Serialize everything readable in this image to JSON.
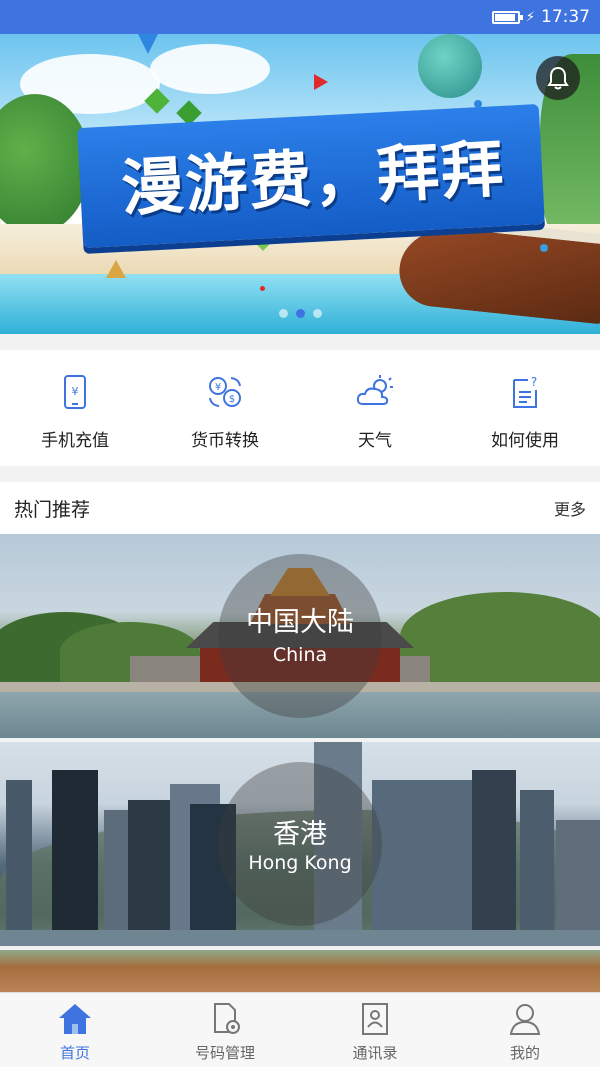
{
  "status_bar": {
    "time": "17:37"
  },
  "banner": {
    "headline": "漫游费，拜拜",
    "slide_count": 3,
    "active_slide": 2
  },
  "quick_actions": [
    {
      "label": "手机充值",
      "icon": "phone-recharge-icon"
    },
    {
      "label": "货币转换",
      "icon": "currency-exchange-icon"
    },
    {
      "label": "天气",
      "icon": "weather-icon"
    },
    {
      "label": "如何使用",
      "icon": "help-document-icon"
    }
  ],
  "hot": {
    "title": "热门推荐",
    "more": "更多",
    "destinations": [
      {
        "name_zh": "中国大陆",
        "name_en": "China"
      },
      {
        "name_zh": "香港",
        "name_en": "Hong Kong"
      }
    ]
  },
  "tabbar": {
    "items": [
      {
        "label": "首页",
        "icon": "home-icon",
        "active": true
      },
      {
        "label": "号码管理",
        "icon": "number-manage-icon",
        "active": false
      },
      {
        "label": "通讯录",
        "icon": "contacts-icon",
        "active": false
      },
      {
        "label": "我的",
        "icon": "profile-icon",
        "active": false
      }
    ]
  },
  "colors": {
    "primary": "#3f74e0",
    "tab_inactive": "#666666"
  }
}
